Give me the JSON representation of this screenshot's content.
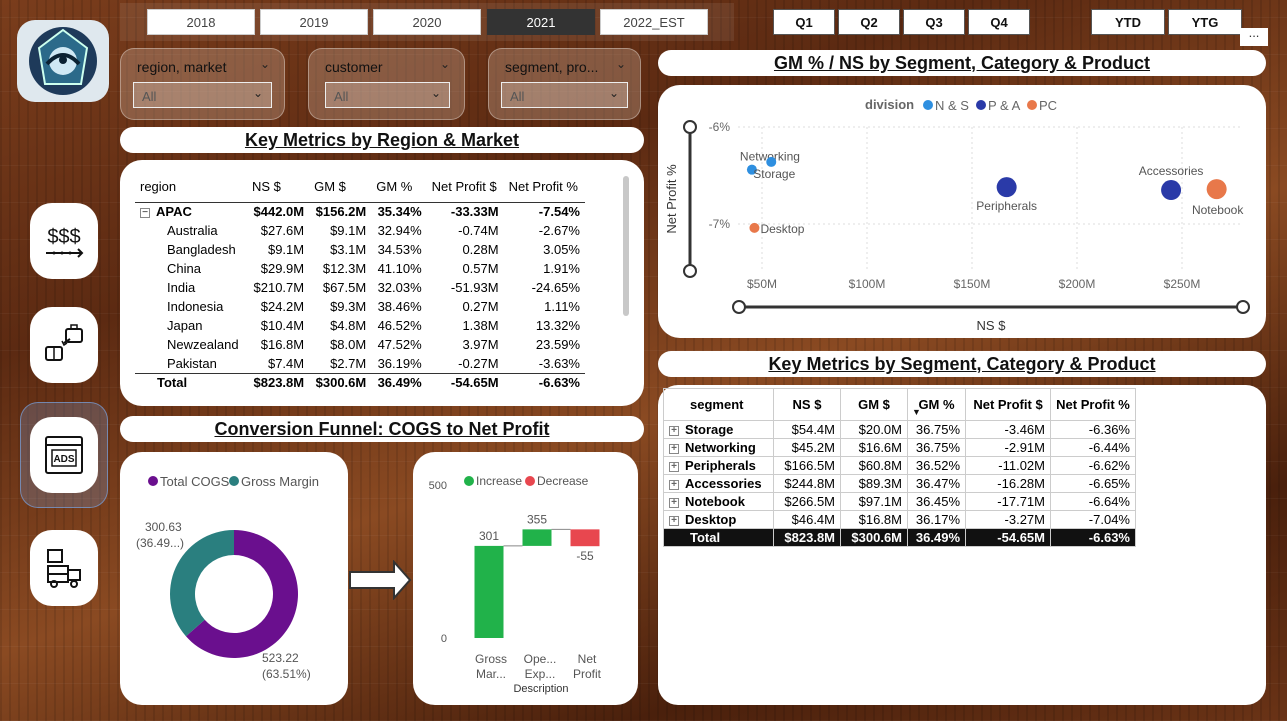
{
  "years": [
    "2018",
    "2019",
    "2020",
    "2021",
    "2022_EST"
  ],
  "active_year": "2021",
  "quarters": [
    "Q1",
    "Q2",
    "Q3",
    "Q4"
  ],
  "ytd": "YTD",
  "ytg": "YTG",
  "more": "...",
  "slicers": [
    {
      "label": "region, market",
      "value": "All"
    },
    {
      "label": "customer",
      "value": "All"
    },
    {
      "label": "segment, pro...",
      "value": "All"
    }
  ],
  "nav": [
    "sales-view",
    "finance-view",
    "marketing-view",
    "supply-chain-view"
  ],
  "nav_text": {
    "sales": "$$$",
    "ads": "ADS"
  },
  "region_table": {
    "title": "Key Metrics by Region & Market",
    "columns": [
      "region",
      "NS $",
      "GM $",
      "GM %",
      "Net Profit $",
      "Net Profit %"
    ],
    "group": {
      "name": "APAC",
      "values": [
        "$442.0M",
        "$156.2M",
        "35.34%",
        "-33.33M",
        "-7.54%"
      ]
    },
    "rows": [
      {
        "name": "Australia",
        "values": [
          "$27.6M",
          "$9.1M",
          "32.94%",
          "-0.74M",
          "-2.67%"
        ]
      },
      {
        "name": "Bangladesh",
        "values": [
          "$9.1M",
          "$3.1M",
          "34.53%",
          "0.28M",
          "3.05%"
        ]
      },
      {
        "name": "China",
        "values": [
          "$29.9M",
          "$12.3M",
          "41.10%",
          "0.57M",
          "1.91%"
        ]
      },
      {
        "name": "India",
        "values": [
          "$210.7M",
          "$67.5M",
          "32.03%",
          "-51.93M",
          "-24.65%"
        ]
      },
      {
        "name": "Indonesia",
        "values": [
          "$24.2M",
          "$9.3M",
          "38.46%",
          "0.27M",
          "1.11%"
        ]
      },
      {
        "name": "Japan",
        "values": [
          "$10.4M",
          "$4.8M",
          "46.52%",
          "1.38M",
          "13.32%"
        ]
      },
      {
        "name": "Newzealand",
        "values": [
          "$16.8M",
          "$8.0M",
          "47.52%",
          "3.97M",
          "23.59%"
        ]
      },
      {
        "name": "Pakistan",
        "values": [
          "$7.4M",
          "$2.7M",
          "36.19%",
          "-0.27M",
          "-3.63%"
        ]
      }
    ],
    "total": {
      "name": "Total",
      "values": [
        "$823.8M",
        "$300.6M",
        "36.49%",
        "-54.65M",
        "-6.63%"
      ]
    }
  },
  "funnel_title": "Conversion Funnel: COGS to Net Profit",
  "donut": {
    "legend": [
      "Total COGS",
      "Gross Margin"
    ],
    "colors": [
      "#6a0f8e",
      "#2a7f7f"
    ],
    "values": [
      523.22,
      300.63
    ],
    "label_cogs_value": "523.22",
    "label_cogs_pct": "(63.51%)",
    "label_gm_value": "300.63",
    "label_gm_pct": "(36.49...)"
  },
  "waterfall": {
    "legend": [
      "Increase",
      "Decrease"
    ],
    "colors": {
      "increase": "#21b24a",
      "decrease": "#e8474f"
    },
    "categories": [
      "Gross Mar...",
      "Ope... Exp...",
      "Net Profit"
    ],
    "category_lines": [
      [
        "Gross",
        "Mar..."
      ],
      [
        "Ope...",
        "Exp..."
      ],
      [
        "Net",
        "Profit"
      ]
    ],
    "values": [
      301,
      355,
      -55
    ],
    "labels": [
      "301",
      "355",
      "-55"
    ],
    "y_ticks": [
      "500",
      "0"
    ],
    "y_tick_values": [
      500,
      0
    ],
    "xlabel": "Description"
  },
  "scatter_title": "GM % / NS by Segment, Category & Product",
  "scatter": {
    "legend_title": "division",
    "legend": [
      "N & S",
      "P & A",
      "PC"
    ],
    "colors": {
      "N & S": "#2e8fe0",
      "P & A": "#2a3aa8",
      "PC": "#e8784a"
    },
    "x_ticks": [
      "$50M",
      "$100M",
      "$150M",
      "$200M",
      "$250M"
    ],
    "x_tick_values": [
      50,
      100,
      150,
      200,
      250
    ],
    "y_ticks": [
      "-6%",
      "-7%"
    ],
    "y_tick_values": [
      -6,
      -7
    ],
    "xlabel": "NS $",
    "ylabel": "Net Profit %",
    "points": [
      {
        "label": "Networking",
        "division": "N & S",
        "x": 45.2,
        "y": -6.44
      },
      {
        "label": "Storage",
        "division": "N & S",
        "x": 54.4,
        "y": -6.36
      },
      {
        "label": "Peripherals",
        "division": "P & A",
        "x": 166.5,
        "y": -6.62
      },
      {
        "label": "Accessories",
        "division": "P & A",
        "x": 244.8,
        "y": -6.65
      },
      {
        "label": "Notebook",
        "division": "PC",
        "x": 266.5,
        "y": -6.64
      },
      {
        "label": "Desktop",
        "division": "PC",
        "x": 46.4,
        "y": -7.04
      }
    ]
  },
  "segment_table": {
    "title": "Key Metrics by Segment, Category & Product",
    "columns": [
      "segment",
      "NS $",
      "GM $",
      "GM %",
      "Net Profit $",
      "Net Profit %"
    ],
    "rows": [
      {
        "name": "Storage",
        "values": [
          "$54.4M",
          "$20.0M",
          "36.75%",
          "-3.46M",
          "-6.36%"
        ]
      },
      {
        "name": "Networking",
        "values": [
          "$45.2M",
          "$16.6M",
          "36.75%",
          "-2.91M",
          "-6.44%"
        ]
      },
      {
        "name": "Peripherals",
        "values": [
          "$166.5M",
          "$60.8M",
          "36.52%",
          "-11.02M",
          "-6.62%"
        ]
      },
      {
        "name": "Accessories",
        "values": [
          "$244.8M",
          "$89.3M",
          "36.47%",
          "-16.28M",
          "-6.65%"
        ]
      },
      {
        "name": "Notebook",
        "values": [
          "$266.5M",
          "$97.1M",
          "36.45%",
          "-17.71M",
          "-6.64%"
        ]
      },
      {
        "name": "Desktop",
        "values": [
          "$46.4M",
          "$16.8M",
          "36.17%",
          "-3.27M",
          "-7.04%"
        ]
      }
    ],
    "total": {
      "name": "Total",
      "values": [
        "$823.8M",
        "$300.6M",
        "36.49%",
        "-54.65M",
        "-6.63%"
      ]
    }
  },
  "chart_data": [
    {
      "type": "scatter",
      "title": "GM % / NS by Segment, Category & Product",
      "xlabel": "NS $",
      "ylabel": "Net Profit %",
      "legend_title": "division",
      "legend": [
        "N & S",
        "P & A",
        "PC"
      ],
      "legend_position": "top",
      "x_ticks": [
        "$50M",
        "$100M",
        "$150M",
        "$200M",
        "$250M"
      ],
      "y_ticks": [
        "-6%",
        "-7%"
      ],
      "grid": true,
      "series": [
        {
          "name": "N & S",
          "points": [
            {
              "label": "Networking",
              "x": 45.2,
              "y": -6.44
            },
            {
              "label": "Storage",
              "x": 54.4,
              "y": -6.36
            }
          ]
        },
        {
          "name": "P & A",
          "points": [
            {
              "label": "Peripherals",
              "x": 166.5,
              "y": -6.62
            },
            {
              "label": "Accessories",
              "x": 244.8,
              "y": -6.65
            }
          ]
        },
        {
          "name": "PC",
          "points": [
            {
              "label": "Notebook",
              "x": 266.5,
              "y": -6.64
            },
            {
              "label": "Desktop",
              "x": 46.4,
              "y": -7.04
            }
          ]
        }
      ]
    },
    {
      "type": "pie",
      "donut": true,
      "legend": [
        "Total COGS",
        "Gross Margin"
      ],
      "legend_position": "top",
      "categories": [
        "Total COGS",
        "Gross Margin"
      ],
      "values": [
        523.22,
        300.63
      ],
      "percent": [
        63.51,
        36.49
      ]
    },
    {
      "type": "bar",
      "waterfall": true,
      "xlabel": "Description",
      "legend": [
        "Increase",
        "Decrease"
      ],
      "legend_position": "top",
      "categories": [
        "Gross Mar...",
        "Ope... Exp...",
        "Net Profit"
      ],
      "values": [
        301,
        355,
        -55
      ],
      "y_ticks": [
        0,
        500
      ]
    }
  ]
}
